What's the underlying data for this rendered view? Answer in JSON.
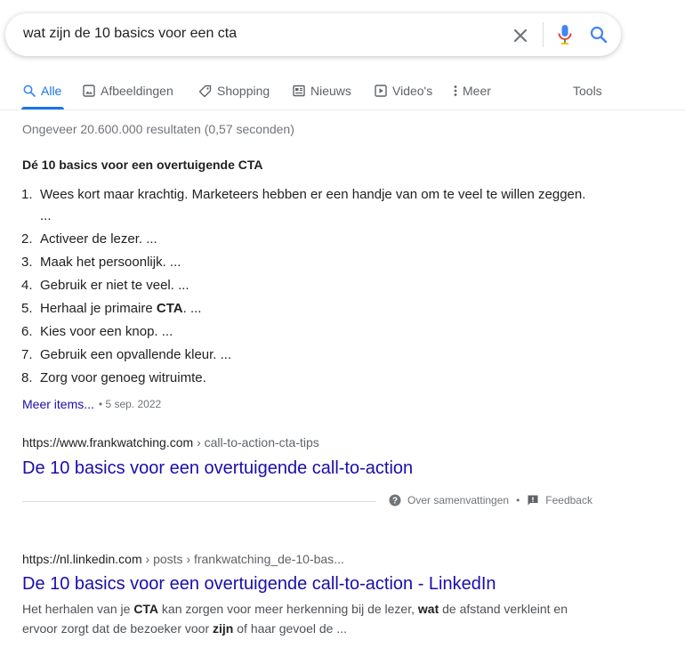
{
  "search": {
    "query": "wat zijn de 10 basics voor een cta"
  },
  "tabs": [
    {
      "label": "Alle",
      "icon": "search-icon",
      "active": true
    },
    {
      "label": "Afbeeldingen",
      "icon": "image-icon"
    },
    {
      "label": "Shopping",
      "icon": "tag-icon"
    },
    {
      "label": "Nieuws",
      "icon": "news-icon"
    },
    {
      "label": "Video's",
      "icon": "play-icon"
    },
    {
      "label": "Meer",
      "icon": "more-vert-icon"
    }
  ],
  "tools_label": "Tools",
  "stats": "Ongeveer 20.600.000 resultaten (0,57 seconden)",
  "snippet": {
    "title": "Dé 10 basics voor een overtuigende CTA",
    "items": [
      {
        "num": "1.",
        "text": "Wees kort maar krachtig. Marketeers hebben er een handje van om te veel te willen zeggen. ..."
      },
      {
        "num": "2.",
        "text": "Activeer de lezer. ..."
      },
      {
        "num": "3.",
        "text": "Maak het persoonlijk. ..."
      },
      {
        "num": "4.",
        "text": "Gebruik er niet te veel. ..."
      },
      {
        "num": "5.",
        "pre": "Herhaal je primaire ",
        "bold": "CTA",
        "post": ". ..."
      },
      {
        "num": "6.",
        "text": "Kies voor een knop. ..."
      },
      {
        "num": "7.",
        "text": "Gebruik een opvallende kleur. ..."
      },
      {
        "num": "8.",
        "text": "Zorg voor genoeg witruimte."
      }
    ],
    "more_link": "Meer items...",
    "date": "• 5 sep. 2022"
  },
  "result1": {
    "url": "https://www.frankwatching.com",
    "crumb": " › call-to-action-cta-tips",
    "title": "De 10 basics voor een overtuigende call-to-action"
  },
  "about": {
    "label": "Over samenvattingen",
    "bullet": "•",
    "feedback": "Feedback"
  },
  "result2": {
    "url": "https://nl.linkedin.com",
    "crumb": " › posts › frankwatching_de-10-bas...",
    "title": "De 10 basics voor een overtuigende call-to-action - LinkedIn",
    "desc": {
      "p1": "Het herhalen van je ",
      "b1": "CTA",
      "p2": " kan zorgen voor meer herkenning bij de lezer, ",
      "b2": "wat",
      "p3": " de afstand verkleint en ervoor zorgt dat de bezoeker voor ",
      "b3": "zijn",
      "p4": " of haar gevoel de ..."
    }
  },
  "colors": {
    "link": "#1a0dab",
    "accent": "#1a73e8",
    "muted": "#70757a"
  }
}
